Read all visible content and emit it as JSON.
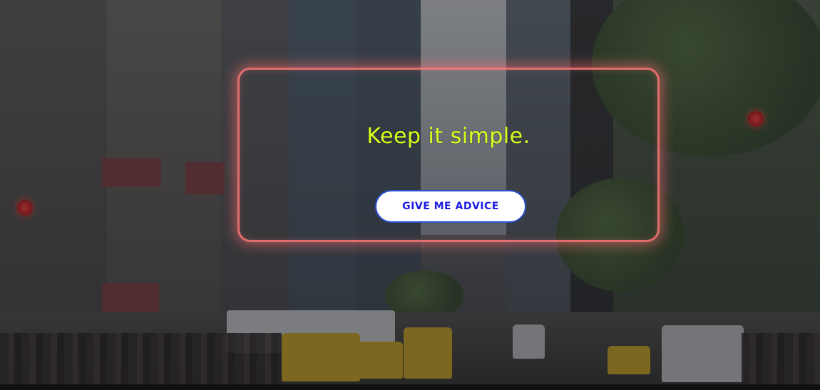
{
  "advice": {
    "text": "Keep it simple.",
    "button_label": "GIVE ME ADVICE"
  },
  "colors": {
    "advice_text": "#d8ff1a",
    "card_border": "#ff7878",
    "button_text": "#1c1ce0",
    "button_border": "#2b4fcf"
  }
}
